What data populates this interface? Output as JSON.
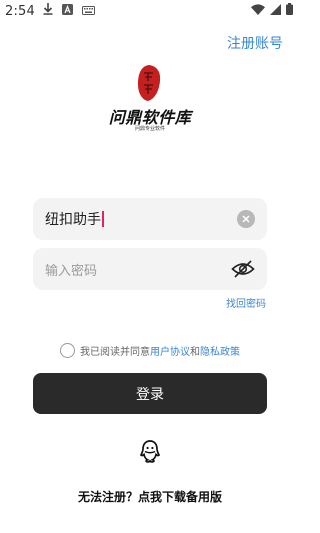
{
  "status_bar": {
    "time": "2:54",
    "icons_left": [
      "download-icon",
      "a-icon",
      "keyboard-icon"
    ],
    "icons_right": [
      "wifi-icon",
      "signal-icon",
      "battery-icon"
    ]
  },
  "header": {
    "register_link": "注册账号"
  },
  "logo": {
    "title": "问鼎软件库",
    "seal_text": "问鼎",
    "subtitle": "问鼎专业软件",
    "seal_color": "#c4201f"
  },
  "login_form": {
    "username_value": "纽扣助手",
    "password_placeholder": "输入密码",
    "forgot_password": "找回密码",
    "agreement_prefix": "我已阅读并同意",
    "user_agreement": "用户协议",
    "and_text": "和",
    "privacy_policy": "隐私政策",
    "login_button": "登录"
  },
  "footer": {
    "download_text": "无法注册？点我下载备用版"
  },
  "colors": {
    "link": "#3a86d6",
    "button_bg": "#2a2a2a",
    "field_bg": "#f3f3f3"
  }
}
